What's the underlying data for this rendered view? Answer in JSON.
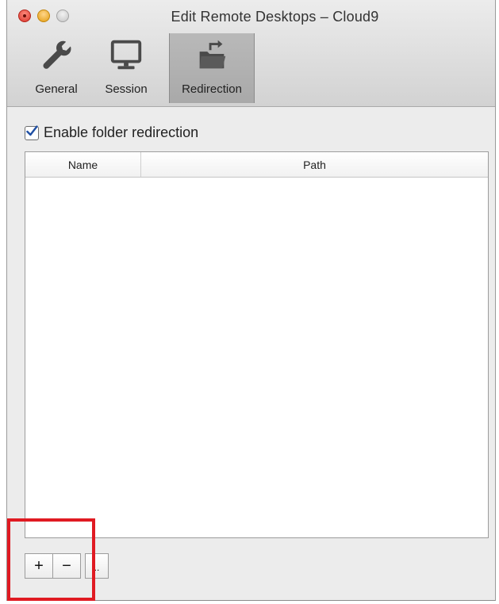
{
  "window": {
    "title": "Edit Remote Desktops – Cloud9"
  },
  "toolbar": {
    "items": [
      {
        "label": "General",
        "icon": "wrench-icon",
        "selected": false
      },
      {
        "label": "Session",
        "icon": "monitor-icon",
        "selected": false
      },
      {
        "label": "Redirection",
        "icon": "folder-redirect-icon",
        "selected": true
      }
    ]
  },
  "redirection": {
    "enable_label": "Enable folder redirection",
    "enabled": true,
    "table": {
      "columns": [
        "Name",
        "Path"
      ],
      "rows": []
    },
    "buttons": {
      "add_label": "+",
      "remove_label": "−",
      "more_label": ".."
    }
  },
  "highlight_color": "#e01a22"
}
